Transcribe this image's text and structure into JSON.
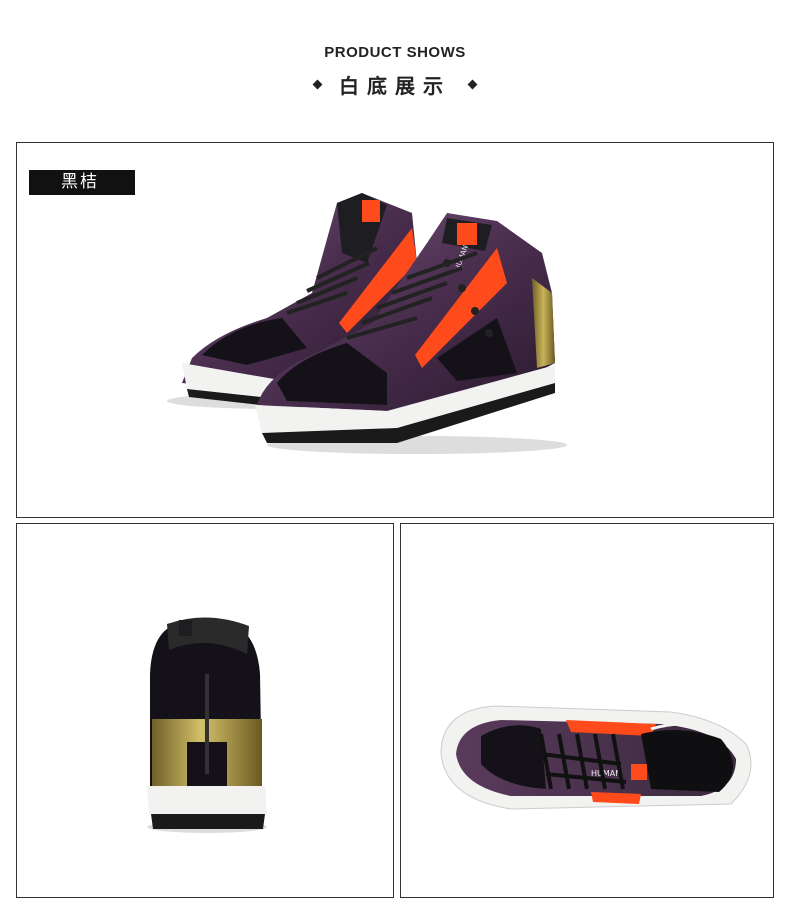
{
  "header": {
    "title_en": "PRODUCT SHOWS",
    "title_cn": "白底展示"
  },
  "main_panel": {
    "color_label": "黑桔",
    "tongue_text": "HUMAN"
  },
  "top_panel": {
    "tongue_text": "HUMAN"
  },
  "colors": {
    "upper_purple": "#5a3a5c",
    "patent_black": "#141218",
    "accent_orange": "#ff4a1c",
    "heel_gold": "#a08a3c",
    "sole_white": "#f2f2f0",
    "outsole_black": "#1a1a1a"
  }
}
